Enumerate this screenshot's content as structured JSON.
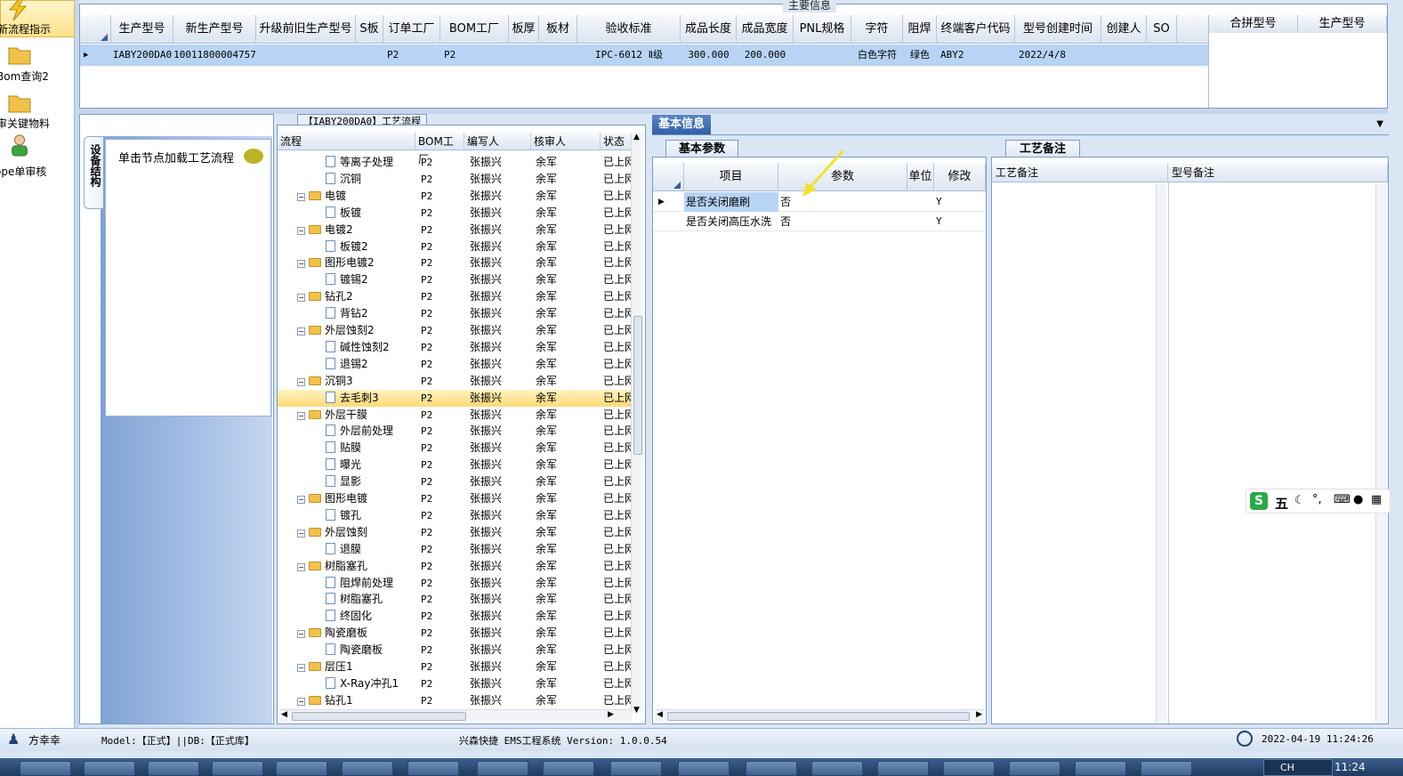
{
  "sidebar": {
    "items": [
      {
        "label": "新流程指示",
        "icon": "lightning-icon"
      },
      {
        "label": "Bom查询2",
        "icon": "folder-icon"
      },
      {
        "label": "审关键物料",
        "icon": "folder-icon"
      },
      {
        "label": "ope单审核",
        "icon": "user-icon"
      }
    ]
  },
  "main_info": {
    "title": "主要信息",
    "columns": [
      "生产型号",
      "新生产型号",
      "升级前旧生产型号",
      "S板",
      "订单工厂",
      "BOM工厂",
      "板厚",
      "板材",
      "验收标准",
      "成品长度",
      "成品宽度",
      "PNL规格",
      "字符",
      "阻焊",
      "终端客户代码",
      "型号创建时间",
      "创建人",
      "SO"
    ],
    "row": [
      "IABY200DA0",
      "10011800004757",
      "",
      "",
      "P2",
      "P2",
      "",
      "",
      "IPC-6012 Ⅱ级",
      "300.000",
      "200.000",
      "",
      "白色字符",
      "绿色",
      "ABY2",
      "2022/4/8",
      "",
      ""
    ],
    "side_columns": [
      "合拼型号",
      "生产型号"
    ]
  },
  "left_panel": {
    "vertical_tab": "设备结构",
    "load_text": "单击节点加载工艺流程"
  },
  "process_tree": {
    "title": "【IABY200DA0】工艺流程",
    "columns": [
      "流程",
      "BOM工厂",
      "编写人",
      "核审人",
      "状态"
    ],
    "rows": [
      {
        "name": "等离子处理",
        "kind": "doc",
        "bom": "P2",
        "writer": "张振兴",
        "reviewer": "余军",
        "status": "已上网"
      },
      {
        "name": "沉铜",
        "kind": "doc",
        "bom": "P2",
        "writer": "张振兴",
        "reviewer": "余军",
        "status": "已上网"
      },
      {
        "name": "电镀",
        "kind": "folder",
        "bom": "P2",
        "writer": "张振兴",
        "reviewer": "余军",
        "status": "已上网"
      },
      {
        "name": "板镀",
        "kind": "doc",
        "bom": "P2",
        "writer": "张振兴",
        "reviewer": "余军",
        "status": "已上网"
      },
      {
        "name": "电镀2",
        "kind": "folder",
        "bom": "P2",
        "writer": "张振兴",
        "reviewer": "余军",
        "status": "已上网"
      },
      {
        "name": "板镀2",
        "kind": "doc",
        "bom": "P2",
        "writer": "张振兴",
        "reviewer": "余军",
        "status": "已上网"
      },
      {
        "name": "图形电镀2",
        "kind": "folder",
        "bom": "P2",
        "writer": "张振兴",
        "reviewer": "余军",
        "status": "已上网"
      },
      {
        "name": "镀锡2",
        "kind": "doc",
        "bom": "P2",
        "writer": "张振兴",
        "reviewer": "余军",
        "status": "已上网"
      },
      {
        "name": "钻孔2",
        "kind": "folder",
        "bom": "P2",
        "writer": "张振兴",
        "reviewer": "余军",
        "status": "已上网"
      },
      {
        "name": "背钻2",
        "kind": "doc",
        "bom": "P2",
        "writer": "张振兴",
        "reviewer": "余军",
        "status": "已上网"
      },
      {
        "name": "外层蚀刻2",
        "kind": "folder",
        "bom": "P2",
        "writer": "张振兴",
        "reviewer": "余军",
        "status": "已上网"
      },
      {
        "name": "碱性蚀刻2",
        "kind": "doc",
        "bom": "P2",
        "writer": "张振兴",
        "reviewer": "余军",
        "status": "已上网"
      },
      {
        "name": "退锡2",
        "kind": "doc",
        "bom": "P2",
        "writer": "张振兴",
        "reviewer": "余军",
        "status": "已上网"
      },
      {
        "name": "沉铜3",
        "kind": "folder",
        "bom": "P2",
        "writer": "张振兴",
        "reviewer": "余军",
        "status": "已上网"
      },
      {
        "name": "去毛刺3",
        "kind": "doc",
        "bom": "P2",
        "writer": "张振兴",
        "reviewer": "余军",
        "status": "已上网",
        "selected": true
      },
      {
        "name": "外层干膜",
        "kind": "folder",
        "bom": "P2",
        "writer": "张振兴",
        "reviewer": "余军",
        "status": "已上网"
      },
      {
        "name": "外层前处理",
        "kind": "doc",
        "bom": "P2",
        "writer": "张振兴",
        "reviewer": "余军",
        "status": "已上网"
      },
      {
        "name": "贴膜",
        "kind": "doc",
        "bom": "P2",
        "writer": "张振兴",
        "reviewer": "余军",
        "status": "已上网"
      },
      {
        "name": "曝光",
        "kind": "doc",
        "bom": "P2",
        "writer": "张振兴",
        "reviewer": "余军",
        "status": "已上网"
      },
      {
        "name": "显影",
        "kind": "doc",
        "bom": "P2",
        "writer": "张振兴",
        "reviewer": "余军",
        "status": "已上网"
      },
      {
        "name": "图形电镀",
        "kind": "folder",
        "bom": "P2",
        "writer": "张振兴",
        "reviewer": "余军",
        "status": "已上网"
      },
      {
        "name": "镀孔",
        "kind": "doc",
        "bom": "P2",
        "writer": "张振兴",
        "reviewer": "余军",
        "status": "已上网"
      },
      {
        "name": "外层蚀刻",
        "kind": "folder",
        "bom": "P2",
        "writer": "张振兴",
        "reviewer": "余军",
        "status": "已上网"
      },
      {
        "name": "退膜",
        "kind": "doc",
        "bom": "P2",
        "writer": "张振兴",
        "reviewer": "余军",
        "status": "已上网"
      },
      {
        "name": "树脂塞孔",
        "kind": "folder",
        "bom": "P2",
        "writer": "张振兴",
        "reviewer": "余军",
        "status": "已上网"
      },
      {
        "name": "阻焊前处理",
        "kind": "doc",
        "bom": "P2",
        "writer": "张振兴",
        "reviewer": "余军",
        "status": "已上网"
      },
      {
        "name": "树脂塞孔",
        "kind": "doc",
        "bom": "P2",
        "writer": "张振兴",
        "reviewer": "余军",
        "status": "已上网"
      },
      {
        "name": "终固化",
        "kind": "doc",
        "bom": "P2",
        "writer": "张振兴",
        "reviewer": "余军",
        "status": "已上网"
      },
      {
        "name": "陶瓷磨板",
        "kind": "folder",
        "bom": "P2",
        "writer": "张振兴",
        "reviewer": "余军",
        "status": "已上网"
      },
      {
        "name": "陶瓷磨板",
        "kind": "doc",
        "bom": "P2",
        "writer": "张振兴",
        "reviewer": "余军",
        "status": "已上网"
      },
      {
        "name": "层压1",
        "kind": "folder",
        "bom": "P2",
        "writer": "张振兴",
        "reviewer": "余军",
        "status": "已上网"
      },
      {
        "name": "X-Ray冲孔1",
        "kind": "doc",
        "bom": "P2",
        "writer": "张振兴",
        "reviewer": "余军",
        "status": "已上网"
      },
      {
        "name": "钻孔1",
        "kind": "folder",
        "bom": "P2",
        "writer": "张振兴",
        "reviewer": "余军",
        "status": "已上网"
      }
    ]
  },
  "basic_info": {
    "tab": "基本信息",
    "params_tab": "基本参数",
    "columns": [
      "项目",
      "参数",
      "单位",
      "修改"
    ],
    "rows": [
      {
        "item": "是否关闭磨刷",
        "value": "否",
        "unit": "",
        "edit": "Y"
      },
      {
        "item": "是否关闭高压水洗",
        "value": "否",
        "unit": "",
        "edit": "Y"
      }
    ],
    "notes_tab": "工艺备注",
    "notes_columns": [
      "工艺备注",
      "型号备注"
    ]
  },
  "ime": {
    "label": "五"
  },
  "status_bar": {
    "user": "方幸幸",
    "model": "Model:【正式】||DB:【正式库】",
    "system": "兴森快捷 EMS工程系统 Version: 1.0.0.54",
    "time": "2022-04-19 11:24:26"
  },
  "taskbar": {
    "clock": "11:24",
    "lang": "CH"
  }
}
